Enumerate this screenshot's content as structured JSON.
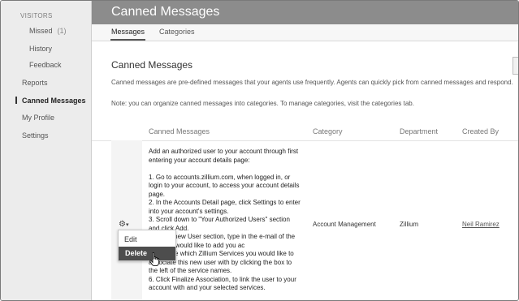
{
  "sidebar": {
    "section": "VISITORS",
    "missed": {
      "label": "Missed",
      "count": "(1)"
    },
    "history": "History",
    "feedback": "Feedback",
    "reports": "Reports",
    "canned_messages": "Canned Messages",
    "my_profile": "My Profile",
    "settings": "Settings"
  },
  "header": {
    "title": "Canned Messages"
  },
  "tabs": {
    "messages": "Messages",
    "categories": "Categories"
  },
  "main": {
    "title": "Canned Messages",
    "description": "Canned messages are pre-defined messages that your agents use frequently. Agents can quickly pick from canned messages and respond.",
    "note": "Note: you can organize canned messages into categories. To manage categories, visit the categories tab."
  },
  "table": {
    "headers": {
      "message": "Canned Messages",
      "category": "Category",
      "department": "Department",
      "created_by": "Created By"
    },
    "row": {
      "message": "Add an authorized user to your account through first entering your account details page:\n\n1. Go to accounts.zillium.com, when logged in, or login to your account, to access your account details page.\n2. In the Accounts Detail page, click Settings to enter into your account's settings.\n3. Scroll down to \"Your Authorized Users\" section and click Add.\n4. In the new User section, type in the e-mail of the user you would like to add you ac\n5. Choose which Zillium Services you would like to associate this new user with by clicking the box to the left of the service names.\n6. Click Finalize Association, to link the user to your account with and your selected services.",
      "category": "Account Management",
      "department": "Zillium",
      "created_by": "Neil Ramirez"
    }
  },
  "menu": {
    "edit": "Edit",
    "delete": "Delete"
  },
  "icons": {
    "gear": "gear-icon",
    "caret": "chevron-down-icon",
    "cursor": "hand-pointer-icon"
  }
}
